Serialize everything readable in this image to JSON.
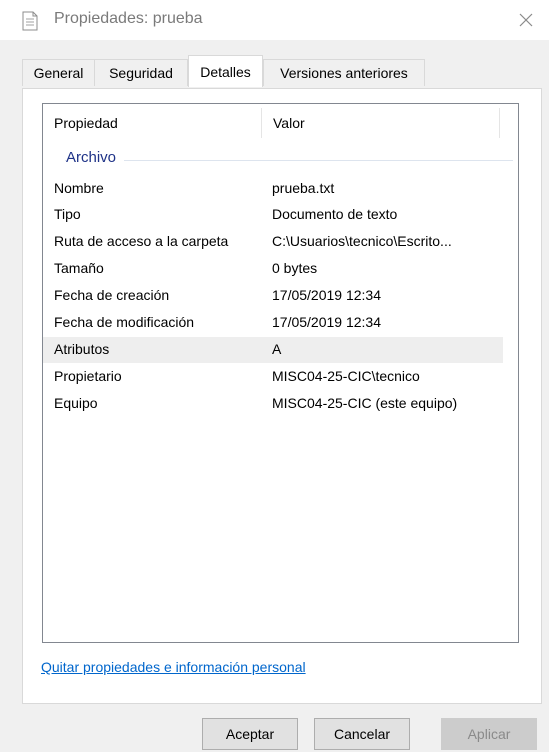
{
  "window": {
    "title": "Propiedades: prueba"
  },
  "tabs": [
    {
      "label": "General"
    },
    {
      "label": "Seguridad"
    },
    {
      "label": "Detalles"
    },
    {
      "label": "Versiones anteriores"
    }
  ],
  "active_tab": "Detalles",
  "list": {
    "columns": {
      "property": "Propiedad",
      "value": "Valor"
    },
    "group": "Archivo",
    "rows": [
      {
        "property": "Nombre",
        "value": "prueba.txt"
      },
      {
        "property": "Tipo",
        "value": "Documento de texto"
      },
      {
        "property": "Ruta de acceso a la carpeta",
        "value": "C:\\Usuarios\\tecnico\\Escrito..."
      },
      {
        "property": "Tamaño",
        "value": "0 bytes"
      },
      {
        "property": "Fecha de creación",
        "value": "17/05/2019 12:34"
      },
      {
        "property": "Fecha de modificación",
        "value": "17/05/2019 12:34"
      },
      {
        "property": "Atributos",
        "value": "A"
      },
      {
        "property": "Propietario",
        "value": "MISC04-25-CIC\\tecnico"
      },
      {
        "property": "Equipo",
        "value": "MISC04-25-CIC (este equipo)"
      }
    ],
    "selected_row": "Atributos"
  },
  "link": {
    "label": "Quitar propiedades e información personal"
  },
  "buttons": {
    "ok": "Aceptar",
    "cancel": "Cancelar",
    "apply": "Aplicar"
  },
  "colors": {
    "group_label": "#1e3287",
    "link": "#0066cc",
    "selected_row": "#eeeeee"
  },
  "icons": {
    "title": "text-document-icon",
    "close": "close-icon"
  }
}
